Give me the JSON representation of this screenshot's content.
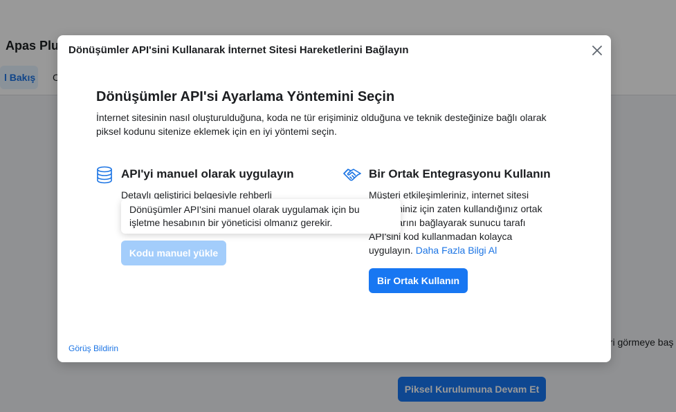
{
  "background": {
    "page_title": "Apas Plus",
    "tabs": [
      {
        "label": "l Bakış",
        "active": true
      },
      {
        "label": "C",
        "active": false
      }
    ],
    "side_text": "eri görmeye baş",
    "continue_button": "Piksel Kurulumuna Devam Et"
  },
  "modal": {
    "title": "Dönüşümler API'sini Kullanarak İnternet Sitesi Hareketlerini Bağlayın",
    "close_icon": "close-icon",
    "section_title": "Dönüşümler API'si Ayarlama Yöntemini Seçin",
    "section_description": "İnternet sitesinin nasıl oluşturulduğuna, koda ne tür erişiminiz olduğuna ve teknik desteğinize bağlı olarak piksel kodunu sitenize eklemek için en iyi yöntemi seçin.",
    "options": {
      "manual": {
        "icon": "database-icon",
        "title": "API'yi manuel olarak uygulayın",
        "description": "Detaylı geliştirici belgesiyle rehberli",
        "button": "Kodu manuel yükle",
        "button_disabled": true
      },
      "partner": {
        "icon": "handshake-icon",
        "title": "Bir Ortak Entegrasyonu Kullanın",
        "description": "Müşteri etkileşimleriniz, internet sitesi yönetiminiz için zaten kullandığınız ortak hesaplarını bağlayarak sunucu tarafı API'sini kod kullanmadan kolayca uygulayın.",
        "link": "Daha Fazla Bilgi Al",
        "button": "Bir Ortak Kullanın"
      }
    },
    "tooltip": "Dönüşümler API'sini manuel olarak uygulamak için bu işletme hesabının bir yöneticisi olmanız gerekir.",
    "feedback_link": "Görüş Bildirin"
  },
  "colors": {
    "primary": "#1877f2",
    "primary_disabled": "#a3cdfb",
    "link": "#1b74e4",
    "text": "#1c1e21",
    "overlay": "rgba(0,0,0,0.4)"
  }
}
